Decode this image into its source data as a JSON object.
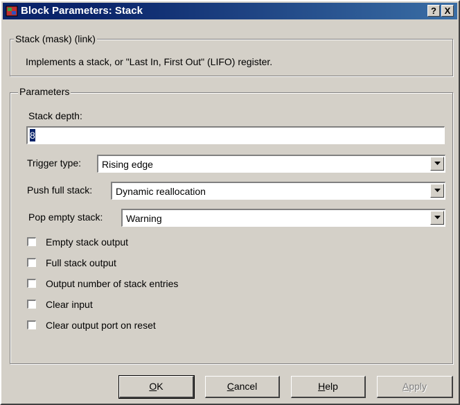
{
  "window": {
    "title": "Block Parameters: Stack",
    "help_btn": "?",
    "close_btn": "X"
  },
  "mask": {
    "group_title": "Stack (mask) (link)",
    "description": "Implements a stack, or \"Last In, First Out\" (LIFO) register."
  },
  "params": {
    "group_title": "Parameters",
    "stack_depth_label": "Stack depth:",
    "stack_depth_value": "8",
    "trigger_label": "Trigger type:",
    "trigger_value": "Rising edge",
    "push_label": "Push full stack:",
    "push_value": "Dynamic reallocation",
    "pop_label": "Pop empty stack:",
    "pop_value": "Warning",
    "checkboxes": [
      {
        "label": "Empty stack output",
        "checked": false
      },
      {
        "label": "Full stack output",
        "checked": false
      },
      {
        "label": "Output number of stack entries",
        "checked": false
      },
      {
        "label": "Clear input",
        "checked": false
      },
      {
        "label": "Clear output port on reset",
        "checked": false
      }
    ]
  },
  "buttons": {
    "ok_mnemonic": "O",
    "ok_rest": "K",
    "cancel_mnemonic": "C",
    "cancel_rest": "ancel",
    "help_mnemonic": "H",
    "help_rest": "elp",
    "apply_mnemonic": "A",
    "apply_rest": "pply"
  }
}
